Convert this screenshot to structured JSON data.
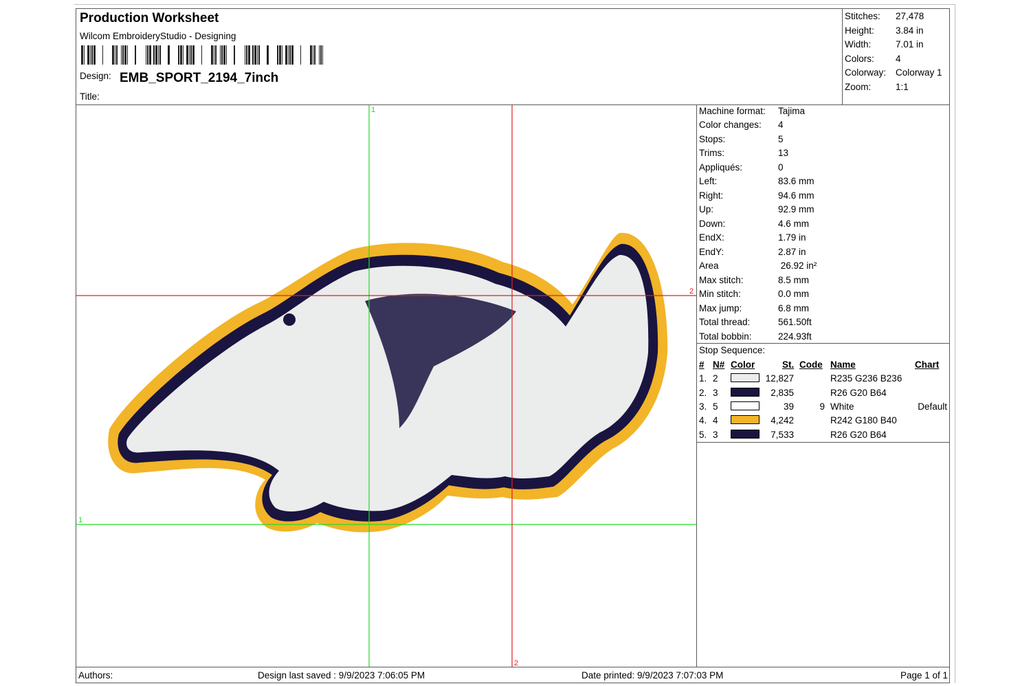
{
  "header": {
    "title": "Production Worksheet",
    "subtitle": "Wilcom EmbroideryStudio - Designing",
    "design_label": "Design:",
    "design_value": "EMB_SPORT_2194_7inch",
    "title_label": "Title:"
  },
  "summary": [
    {
      "label": "Stitches:",
      "value": "27,478"
    },
    {
      "label": "Height:",
      "value": "3.84 in"
    },
    {
      "label": "Width:",
      "value": "7.01 in"
    },
    {
      "label": "Colors:",
      "value": "4"
    },
    {
      "label": "Colorway:",
      "value": "Colorway 1"
    },
    {
      "label": "Zoom:",
      "value": "1:1"
    }
  ],
  "machine": [
    {
      "label": "Machine format:",
      "value": "Tajima"
    },
    {
      "label": "Color changes:",
      "value": "4"
    },
    {
      "label": "Stops:",
      "value": "5"
    },
    {
      "label": "Trims:",
      "value": "13"
    },
    {
      "label": "Appliqués:",
      "value": "0"
    },
    {
      "label": "Left:",
      "value": "83.6 mm"
    },
    {
      "label": "Right:",
      "value": "94.6 mm"
    },
    {
      "label": "Up:",
      "value": "92.9 mm"
    },
    {
      "label": "Down:",
      "value": "4.6 mm"
    },
    {
      "label": "EndX:",
      "value": "1.79 in"
    },
    {
      "label": "EndY:",
      "value": "2.87 in"
    },
    {
      "label": "Area",
      "value": " 26.92 in²"
    },
    {
      "label": "Max stitch:",
      "value": "8.5 mm"
    },
    {
      "label": "Min stitch:",
      "value": "0.0 mm"
    },
    {
      "label": "Max jump:",
      "value": "6.8 mm"
    },
    {
      "label": "Total thread:",
      "value": "561.50ft"
    },
    {
      "label": "Total bobbin:",
      "value": "224.93ft"
    }
  ],
  "stop_sequence": {
    "title": "Stop Sequence:",
    "headers": {
      "idx": "#",
      "needle": "N#",
      "color": "Color",
      "stitches": "St.",
      "code": "Code",
      "name": "Name",
      "chart": "Chart"
    },
    "rows": [
      {
        "idx": "1.",
        "needle": "2",
        "swatch": "#ebecec",
        "stitches": "12,827",
        "code": "",
        "name": "R235 G236 B236",
        "chart": ""
      },
      {
        "idx": "2.",
        "needle": "3",
        "swatch": "#1a1440",
        "stitches": "2,835",
        "code": "",
        "name": "R26 G20 B64",
        "chart": ""
      },
      {
        "idx": "3.",
        "needle": "5",
        "swatch": "#ffffff",
        "stitches": "39",
        "code": "9",
        "name": "White",
        "chart": "Default"
      },
      {
        "idx": "4.",
        "needle": "4",
        "swatch": "#f2b428",
        "stitches": "4,242",
        "code": "",
        "name": "R242 G180 B40",
        "chart": ""
      },
      {
        "idx": "5.",
        "needle": "3",
        "swatch": "#1a1440",
        "stitches": "7,533",
        "code": "",
        "name": "R26 G20 B64",
        "chart": ""
      }
    ]
  },
  "guides": {
    "green_v_label": "1",
    "green_h_label": "1",
    "red_v_label": "2",
    "red_h_label": "2",
    "green": "#22dd22",
    "red": "#e02020"
  },
  "artwork_colors": {
    "fill": "#ebecec",
    "outline": "#1a1440",
    "border": "#f2b428"
  },
  "footer": {
    "authors": "Authors:",
    "saved": "Design last saved : 9/9/2023 7:06:05 PM",
    "printed": "Date printed: 9/9/2023 7:07:03 PM",
    "page": "Page 1 of 1"
  }
}
